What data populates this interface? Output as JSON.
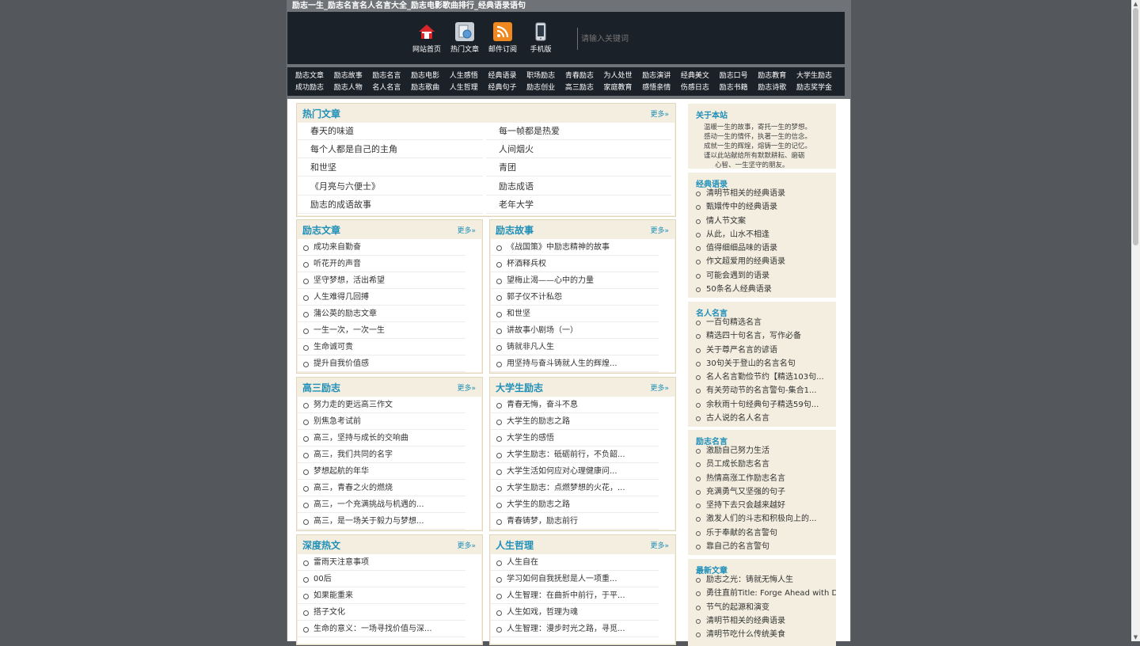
{
  "site_title": "励志一生_励志名言名人名言大全_励志电影歌曲排行_经典语录语句",
  "header_nav": [
    {
      "label": "网站首页",
      "icon": "home-icon"
    },
    {
      "label": "热门文章",
      "icon": "globe-document-icon"
    },
    {
      "label": "邮件订阅",
      "icon": "rss-icon"
    },
    {
      "label": "手机版",
      "icon": "mobile-phone-icon"
    }
  ],
  "search": {
    "placeholder": "请输入关键词"
  },
  "categories": [
    [
      "励志文章",
      "励志故事",
      "励志名言",
      "励志电影",
      "人生感悟",
      "经典语录",
      "职场励志",
      "青春励志",
      "为人处世",
      "励志演讲",
      "经典美文",
      "励志口号",
      "励志教育",
      "大学生励志"
    ],
    [
      "成功励志",
      "励志人物",
      "名人名言",
      "励志歌曲",
      "人生哲理",
      "经典句子",
      "励志创业",
      "高三励志",
      "家庭教育",
      "感悟亲情",
      "伤感日志",
      "励志书籍",
      "励志诗歌",
      "励志奖学金"
    ]
  ],
  "more_label": "更多»",
  "hot": {
    "title": "热门文章",
    "items": [
      "春天的味道",
      "每一帧都是热爱",
      "每个人都是自己的主角",
      "人间烟火",
      "和世坚",
      "青团",
      "《月亮与六便士》",
      "励志成语",
      "励志的成语故事",
      "老年大学"
    ]
  },
  "sections": [
    {
      "title": "励志文章",
      "items": [
        "成功来自勤奋",
        "听花开的声音",
        "坚守梦想，活出希望",
        "人生难得几回搏",
        "蒲公英的励志文章",
        "一生一次，一次一生",
        "生命诚可贵",
        "提升自我价值感"
      ]
    },
    {
      "title": "励志故事",
      "items": [
        "《战国策》中励志精神的故事",
        "杯酒释兵权",
        "望梅止渴——心中的力量",
        "郭子仪不计私怨",
        "和世坚",
        "讲故事小剧场（一）",
        "铸就非凡人生",
        "用坚持与奋斗铸就人生的辉煌..."
      ]
    },
    {
      "title": "高三励志",
      "items": [
        "努力走的更远高三作文",
        "别焦急考试前",
        "高三，坚持与成长的交响曲",
        "高三，我们共同的名字",
        "梦想起航的年华",
        "高三，青春之火的燃烧",
        "高三，一个充满挑战与机遇的...",
        "高三，是一场关于毅力与梦想..."
      ]
    },
    {
      "title": "大学生励志",
      "items": [
        "青春无悔，奋斗不息",
        "大学生的励志之路",
        "大学生的感悟",
        "大学生励志：砥砺前行，不负韶...",
        "大学生活如何应对心理健康问...",
        "大学生励志：点燃梦想的火花，...",
        "大学生的励志之路",
        "青春铸梦，励志前行"
      ]
    },
    {
      "title": "深度热文",
      "items": [
        "雷雨天注意事项",
        "00后",
        "如果能重来",
        "搭子文化",
        "生命的意义：一场寻找价值与深..."
      ]
    },
    {
      "title": "人生哲理",
      "items": [
        "人生自在",
        "学习如何自我抚慰是人一项重...",
        "人生智理：在曲折中前行，于平...",
        "人生如戏，哲理为魂",
        "人生智理：漫步时光之路，寻觅..."
      ]
    }
  ],
  "sidebar": {
    "about": {
      "title": "关于本站",
      "lines": [
        "温暖一生的故事，寄托一生的梦想。",
        "感动一生的情怀，执著一生的信念。",
        "成就一生的辉煌，熔铸一生的记忆。",
        "谨以此站献给所有默默耕耘、磨砺",
        "心智、一生坚守的朋友。"
      ]
    },
    "blocks": [
      {
        "title": "经典语录",
        "items": [
          "清明节相关的经典语录",
          "甄嬛传中的经典语录",
          "情人节文案",
          "从此，山水不相逢",
          "值得细细品味的语录",
          "作文超爱用的经典语录",
          "可能会遇到的语录",
          "50条名人经典语录"
        ]
      },
      {
        "title": "名人名言",
        "items": [
          "一百句精选名言",
          "精选四十句名言，写作必备",
          "关于尊严名言的谚语",
          "30句关于登山的名言名句",
          "名人名言勤俭节约【精选103句...",
          "有关劳动节的名言警句-集合1...",
          "余秋雨十句经典句子精选59句...",
          "古人说的名人名言"
        ]
      },
      {
        "title": "励志名言",
        "items": [
          "激励自己努力生活",
          "员工成长励志名言",
          "热情高涨工作励志名言",
          "充满勇气又坚强的句子",
          "坚持下去只会越来越好",
          "激发人们的斗志和积极向上的...",
          "乐于奉献的名言警句",
          "靠自己的名言警句"
        ]
      },
      {
        "title": "最新文章",
        "items": [
          "励志之光：铸就无悔人生",
          "勇往直前Title: Forge Ahead with Determination",
          "节气的起源和演变",
          "清明节相关的经典语录",
          "清明节吃什么传统美食"
        ]
      }
    ]
  }
}
